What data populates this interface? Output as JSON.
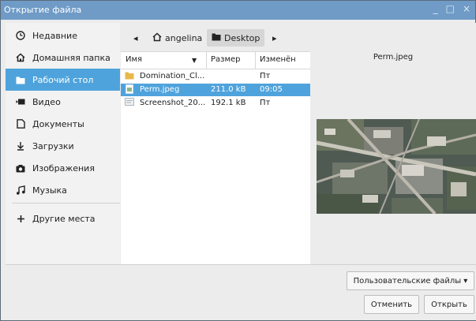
{
  "window": {
    "title": "Открытие файла",
    "controls": [
      "_",
      "□",
      "×"
    ]
  },
  "sidebar": {
    "items": [
      {
        "label": "Недавние",
        "icon": "clock-icon"
      },
      {
        "label": "Домашняя папка",
        "icon": "home-icon"
      },
      {
        "label": "Рабочий стол",
        "icon": "folder-icon",
        "active": true
      },
      {
        "label": "Видео",
        "icon": "video-icon"
      },
      {
        "label": "Документы",
        "icon": "document-icon"
      },
      {
        "label": "Загрузки",
        "icon": "download-icon"
      },
      {
        "label": "Изображения",
        "icon": "camera-icon"
      },
      {
        "label": "Музыка",
        "icon": "music-icon"
      }
    ],
    "other": {
      "label": "Другие места",
      "icon": "plus-icon"
    }
  },
  "pathbar": {
    "back_icon": "◂",
    "home_label": "angelina",
    "current_label": "Desktop",
    "forward_icon": "▸"
  },
  "filelist": {
    "columns": {
      "name": "Имя",
      "size": "Размер",
      "modified": "Изменён"
    },
    "rows": [
      {
        "name": "Domination_Cl...",
        "size": "",
        "modified": "Пт",
        "icon": "folder-icon"
      },
      {
        "name": "Perm.jpeg",
        "size": "211.0 kB",
        "modified": "09:05",
        "icon": "image-file-icon",
        "selected": true
      },
      {
        "name": "Screenshot_20...",
        "size": "192.1 kB",
        "modified": "Пт",
        "icon": "image-file-icon"
      }
    ]
  },
  "preview": {
    "title": "Perm.jpeg"
  },
  "filter": {
    "label": "Пользовательские файлы ▾"
  },
  "buttons": {
    "cancel": "Отменить",
    "open": "Открыть"
  }
}
